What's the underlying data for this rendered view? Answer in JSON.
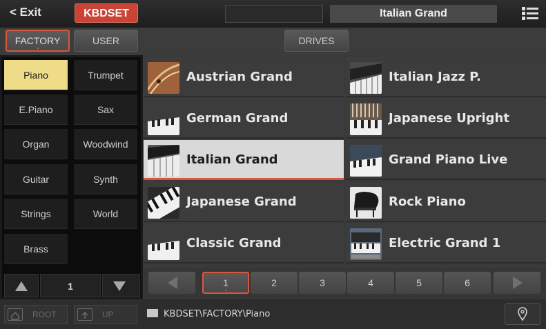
{
  "topbar": {
    "exit_label": "< Exit",
    "mode_badge": "KBDSET",
    "current_sound": "Italian Grand",
    "menu_icon": "hamburger-list-icon"
  },
  "tabs": {
    "factory": "FACTORY",
    "user": "USER",
    "drives": "DRIVES"
  },
  "categories": [
    {
      "label": "Piano",
      "selected": true
    },
    {
      "label": "Trumpet"
    },
    {
      "label": "E.Piano"
    },
    {
      "label": "Sax"
    },
    {
      "label": "Organ"
    },
    {
      "label": "Woodwind"
    },
    {
      "label": "Guitar"
    },
    {
      "label": "Synth"
    },
    {
      "label": "Strings"
    },
    {
      "label": "World"
    },
    {
      "label": "Brass"
    }
  ],
  "category_nav": {
    "page": "1"
  },
  "sounds": [
    {
      "label": "Austrian Grand",
      "icon": "piano-strings-thumb"
    },
    {
      "label": "Italian Jazz P.",
      "icon": "piano-keys-thumb"
    },
    {
      "label": "German Grand",
      "icon": "piano-keys-thumb"
    },
    {
      "label": "Japanese Upright",
      "icon": "upright-hammers-thumb"
    },
    {
      "label": "Italian Grand",
      "icon": "piano-keys-thumb",
      "selected": true
    },
    {
      "label": "Grand Piano Live",
      "icon": "piano-keys-thumb"
    },
    {
      "label": "Japanese Grand",
      "icon": "piano-keys-thumb"
    },
    {
      "label": "Rock Piano",
      "icon": "grand-piano-silhouette-thumb"
    },
    {
      "label": "Classic Grand",
      "icon": "piano-keys-thumb"
    },
    {
      "label": "Electric Grand 1",
      "icon": "electric-grand-thumb"
    }
  ],
  "pager": {
    "pages": [
      "1",
      "2",
      "3",
      "4",
      "5",
      "6"
    ],
    "active": "1"
  },
  "statusbar": {
    "root_label": "ROOT",
    "up_label": "UP",
    "path": "KBDSET\\FACTORY\\Piano"
  },
  "colors": {
    "accent": "#d9573f",
    "badge": "#c94436",
    "category_selected": "#eedc88",
    "cell_selected": "#d9d9d9"
  }
}
